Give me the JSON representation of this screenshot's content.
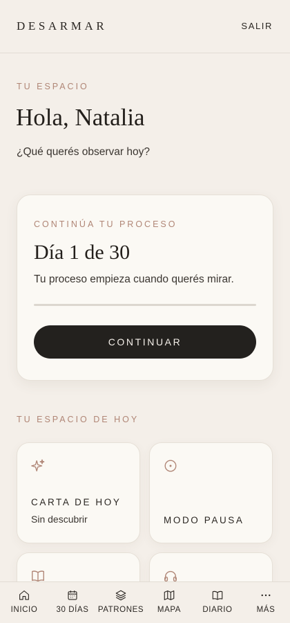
{
  "header": {
    "brand": "DESARMAR",
    "logout_label": "SALIR"
  },
  "intro": {
    "eyebrow": "TU ESPACIO",
    "greeting": "Hola, Natalia",
    "question": "¿Qué querés observar hoy?"
  },
  "process_card": {
    "eyebrow": "CONTINÚA TU PROCESO",
    "day_title": "Día 1 de 30",
    "subtitle": "Tu proceso empieza cuando querés mirar.",
    "progress_fraction": 0,
    "button_label": "CONTINUAR"
  },
  "today": {
    "eyebrow": "TU ESPACIO DE HOY",
    "tiles": [
      {
        "title": "CARTA DE HOY",
        "subtitle": "Sin descubrir",
        "icon": "sparkles-icon"
      },
      {
        "title": "MODO PAUSA",
        "icon": "pause-circle-icon"
      },
      {
        "icon": "open-book-icon"
      },
      {
        "icon": "headphones-icon"
      }
    ]
  },
  "nav": {
    "items": [
      {
        "label": "INICIO",
        "icon": "home-icon"
      },
      {
        "label": "30 DÍAS",
        "icon": "calendar-icon"
      },
      {
        "label": "PATRONES",
        "icon": "layers-icon"
      },
      {
        "label": "MAPA",
        "icon": "map-icon"
      },
      {
        "label": "DIARIO",
        "icon": "book-icon"
      },
      {
        "label": "MÁS",
        "icon": "more-icon"
      }
    ]
  },
  "colors": {
    "background": "#f4efe9",
    "accent": "#b08676",
    "card": "#fbf9f4",
    "button": "#23211e"
  }
}
